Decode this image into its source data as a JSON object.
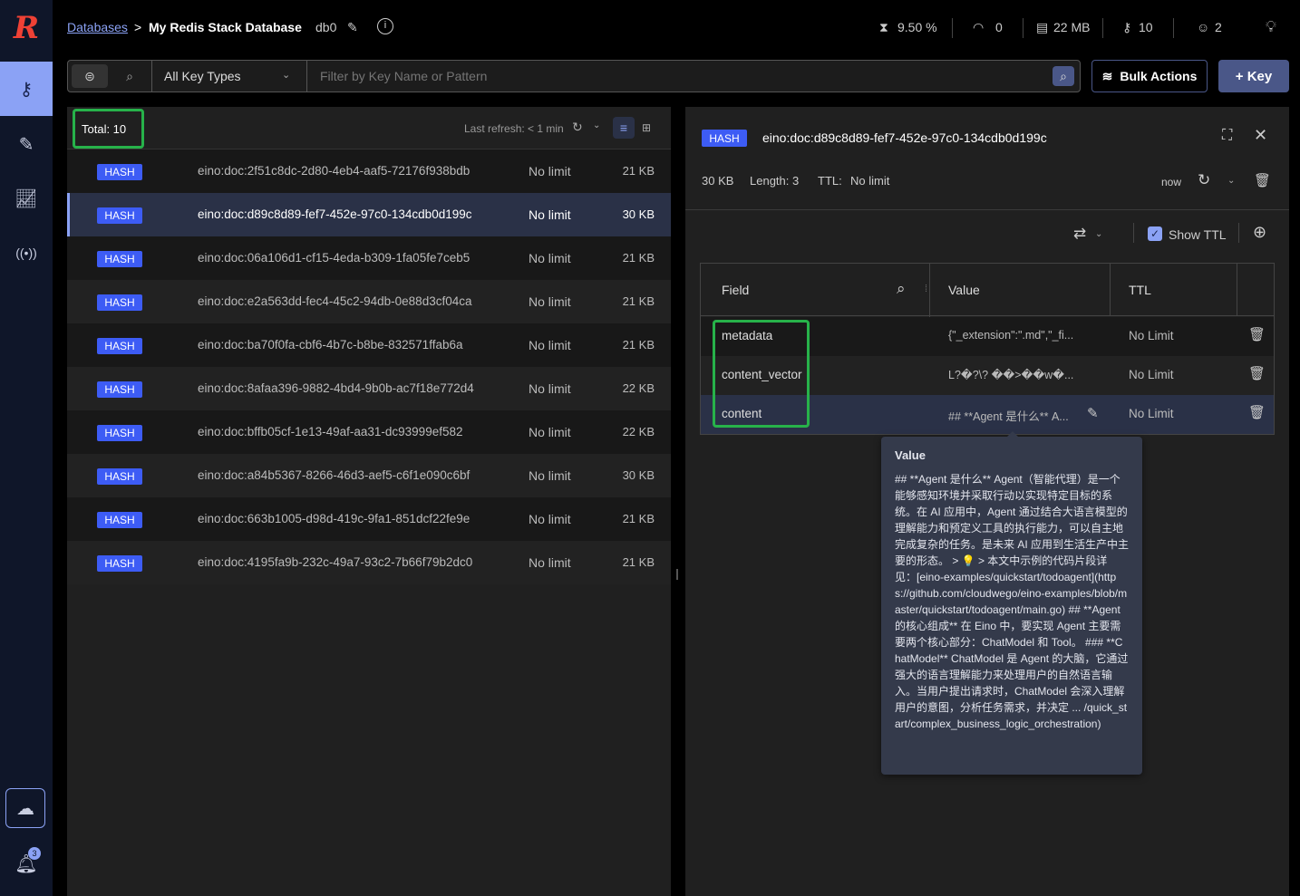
{
  "header": {
    "breadcrumb_link": "Databases",
    "breadcrumb_sep": ">",
    "database_name": "My Redis Stack Database",
    "db_index": "db0",
    "stats": {
      "cpu": "9.50 %",
      "ops": "0",
      "memory": "22 MB",
      "keys": "10",
      "clients": "2"
    }
  },
  "filter": {
    "key_type": "All Key Types",
    "search_placeholder": "Filter by Key Name or Pattern",
    "bulk_actions": "Bulk Actions",
    "add_key": "+ Key"
  },
  "list": {
    "total": "Total: 10",
    "last_refresh": "Last refresh: < 1 min",
    "rows": [
      {
        "type": "HASH",
        "name": "eino:doc:2f51c8dc-2d80-4eb4-aaf5-72176f938bdb",
        "ttl": "No limit",
        "size": "21 KB"
      },
      {
        "type": "HASH",
        "name": "eino:doc:d89c8d89-fef7-452e-97c0-134cdb0d199c",
        "ttl": "No limit",
        "size": "30 KB",
        "selected": true
      },
      {
        "type": "HASH",
        "name": "eino:doc:06a106d1-cf15-4eda-b309-1fa05fe7ceb5",
        "ttl": "No limit",
        "size": "21 KB"
      },
      {
        "type": "HASH",
        "name": "eino:doc:e2a563dd-fec4-45c2-94db-0e88d3cf04ca",
        "ttl": "No limit",
        "size": "21 KB"
      },
      {
        "type": "HASH",
        "name": "eino:doc:ba70f0fa-cbf6-4b7c-b8be-832571ffab6a",
        "ttl": "No limit",
        "size": "21 KB"
      },
      {
        "type": "HASH",
        "name": "eino:doc:8afaa396-9882-4bd4-9b0b-ac7f18e772d4",
        "ttl": "No limit",
        "size": "22 KB"
      },
      {
        "type": "HASH",
        "name": "eino:doc:bffb05cf-1e13-49af-aa31-dc93999ef582",
        "ttl": "No limit",
        "size": "22 KB"
      },
      {
        "type": "HASH",
        "name": "eino:doc:a84b5367-8266-46d3-aef5-c6f1e090c6bf",
        "ttl": "No limit",
        "size": "30 KB"
      },
      {
        "type": "HASH",
        "name": "eino:doc:663b1005-d98d-419c-9fa1-851dcf22fe9e",
        "ttl": "No limit",
        "size": "21 KB"
      },
      {
        "type": "HASH",
        "name": "eino:doc:4195fa9b-232c-49a7-93c2-7b66f79b2dc0",
        "ttl": "No limit",
        "size": "21 KB"
      }
    ]
  },
  "detail": {
    "type": "HASH",
    "key": "eino:doc:d89c8d89-fef7-452e-97c0-134cdb0d199c",
    "size": "30 KB",
    "length": "Length: 3",
    "ttl_label": "TTL:",
    "ttl_value": "No limit",
    "refreshed": "now",
    "show_ttl": "Show TTL",
    "columns": {
      "field": "Field",
      "value": "Value",
      "ttl": "TTL"
    },
    "rows": [
      {
        "field": "metadata",
        "value": "{\"_extension\":\".md\",\"_fi...",
        "ttl": "No Limit"
      },
      {
        "field": "content_vector",
        "value": "L?�?\\? ��>��w�...",
        "ttl": "No Limit"
      },
      {
        "field": "content",
        "value": "## **Agent 是什么** A...",
        "ttl": "No Limit"
      }
    ]
  },
  "tooltip": {
    "title": "Value",
    "text": "## **Agent 是什么** Agent（智能代理）是一个能够感知环境并采取行动以实现特定目标的系统。在 AI 应用中，Agent 通过结合大语言模型的理解能力和预定义工具的执行能力，可以自主地完成复杂的任务。是未来 AI 应用到生活生产中主要的形态。 > 💡 > 本文中示例的代码片段详见：[eino-examples/quickstart/todoagent](https://github.com/cloudwego/eino-examples/blob/master/quickstart/todoagent/main.go) ## **Agent 的核心组成** 在 Eino 中，要实现 Agent 主要需要两个核心部分：ChatModel 和 Tool。 ### **ChatModel** ChatModel 是 Agent 的大脑，它通过强大的语言理解能力来处理用户的自然语言输入。当用户提出请求时，ChatModel 会深入理解用户的意图，分析任务需求，并决定 ... /quick_start/complex_business_logic_orchestration)"
  },
  "notifications": {
    "count": "3"
  },
  "colors": {
    "accent": "#3d5cf5",
    "highlight": "#27b24a",
    "selected_row": "#2a3147"
  }
}
